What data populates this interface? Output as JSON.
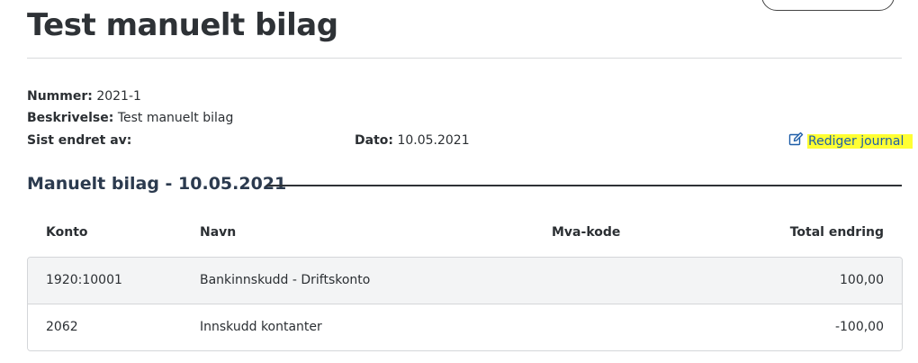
{
  "header": {
    "title": "Test manuelt bilag",
    "top_button_label": ""
  },
  "meta": {
    "number_label": "Nummer:",
    "number_value": "2021-1",
    "description_label": "Beskrivelse:",
    "description_value": "Test manuelt bilag",
    "changed_by_label": "Sist endret av:",
    "changed_by_value": "",
    "date_label": "Dato:",
    "date_value": "10.05.2021"
  },
  "edit_link": {
    "label": "Rediger journal",
    "icon": "edit-icon",
    "highlight_color": "#ffff33",
    "link_color": "#1f5ea8"
  },
  "section": {
    "title": "Manuelt bilag - 10.05.2021"
  },
  "table": {
    "headers": {
      "konto": "Konto",
      "navn": "Navn",
      "mva": "Mva-kode",
      "total": "Total endring"
    },
    "rows": [
      {
        "konto": "1920:10001",
        "navn": "Bankinnskudd - Driftskonto",
        "mva": "",
        "total": "100,00"
      },
      {
        "konto": "2062",
        "navn": "Innskudd kontanter",
        "mva": "",
        "total": "-100,00"
      }
    ]
  }
}
